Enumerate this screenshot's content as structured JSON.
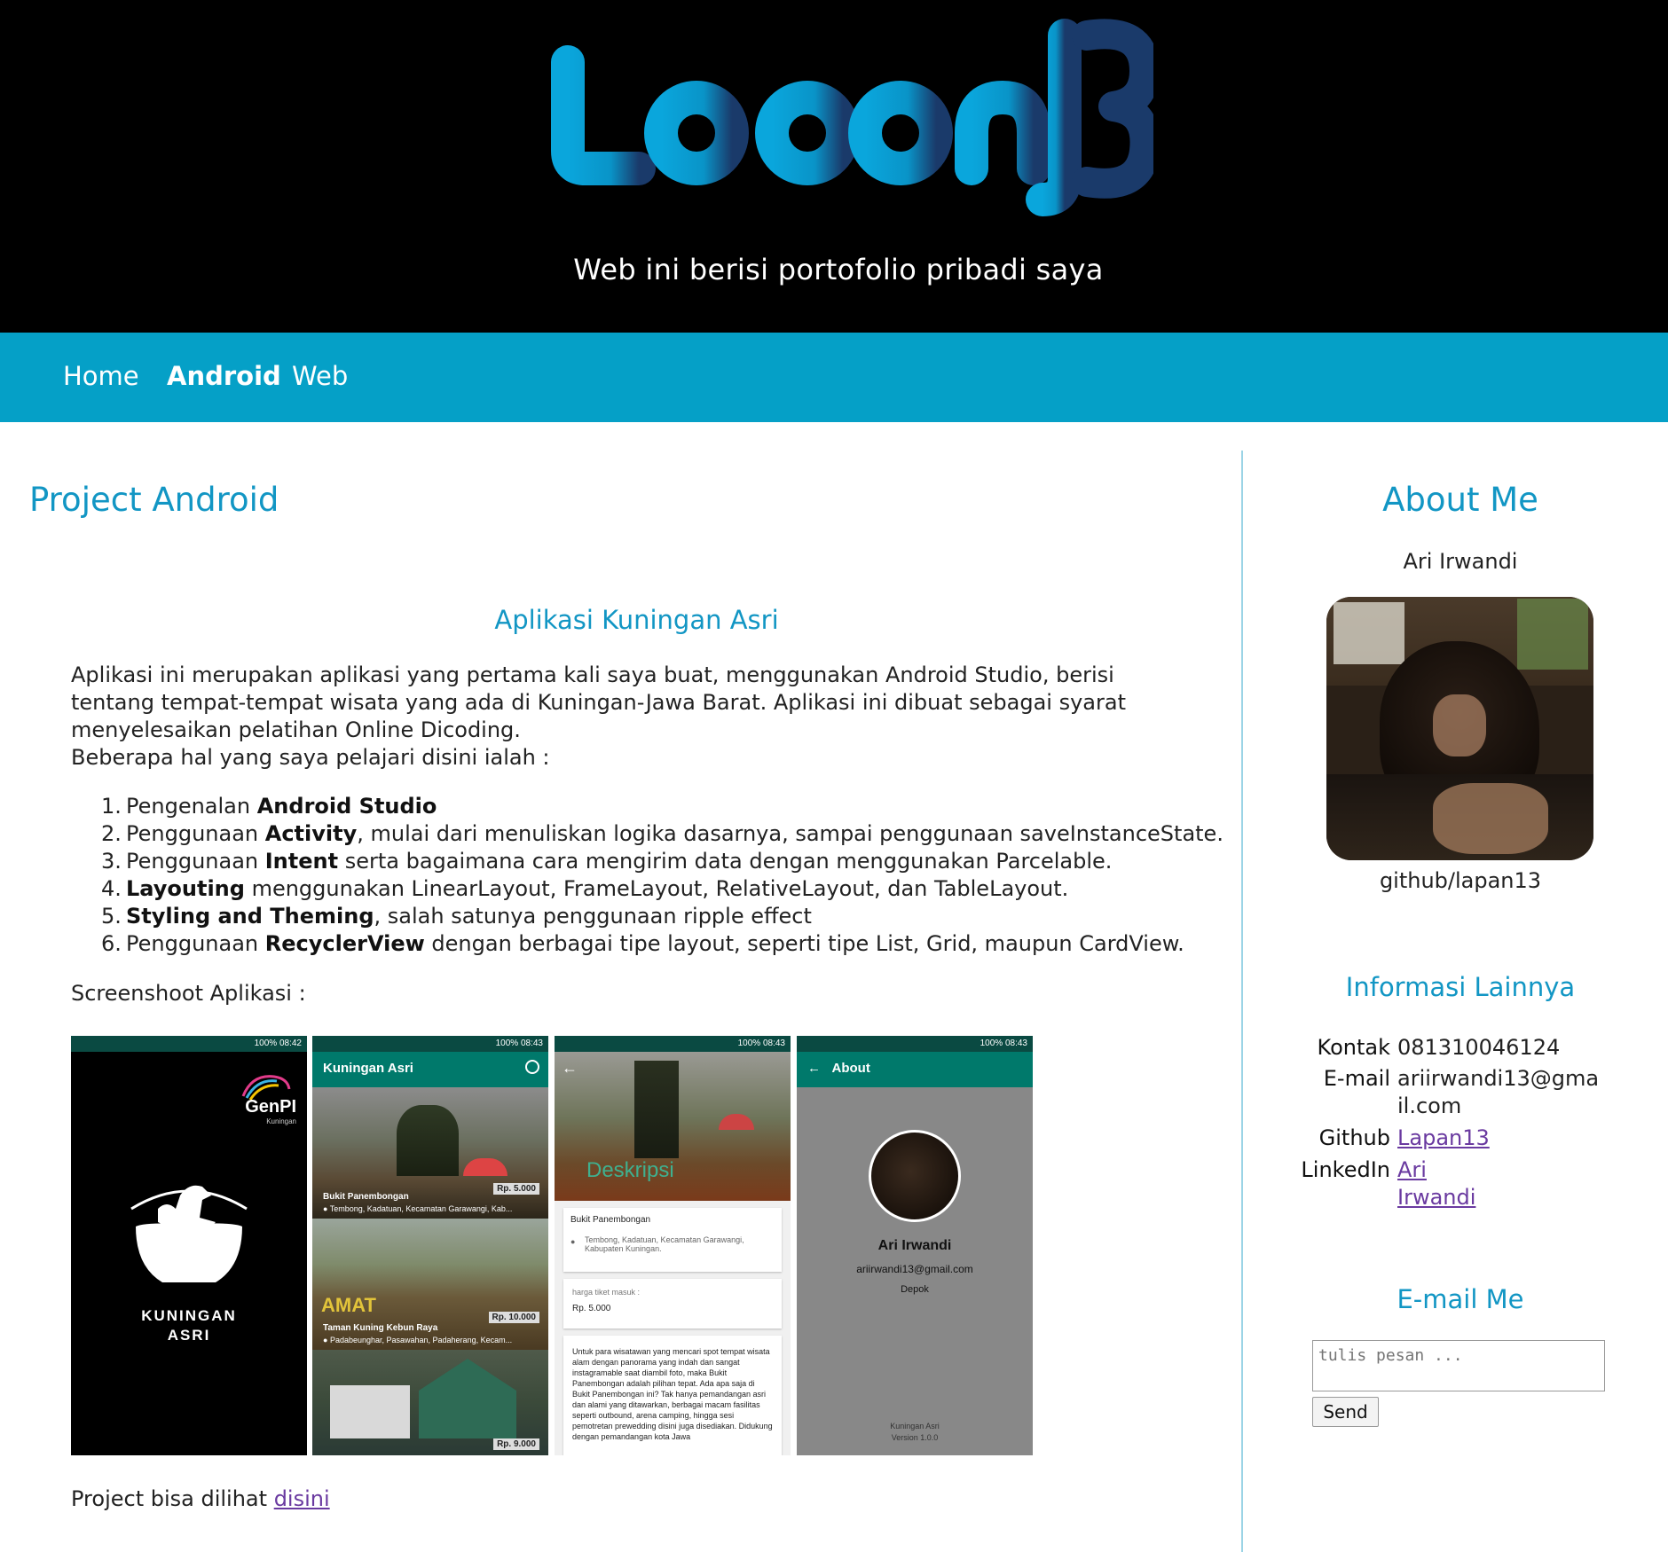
{
  "header": {
    "logo_text": "Lapan13",
    "tagline": "Web ini berisi portofolio pribadi saya"
  },
  "nav": {
    "items": [
      {
        "label": "Home"
      },
      {
        "label": "Android"
      },
      {
        "label": "Web"
      }
    ],
    "active": "Android"
  },
  "main": {
    "page_title": "Project Android",
    "article_title": "Aplikasi Kuningan Asri",
    "intro_paragraph": "Aplikasi ini merupakan aplikasi yang pertama kali saya buat, menggunakan Android Studio, berisi tentang tempat-tempat wisata yang ada di Kuningan-Jawa Barat. Aplikasi ini dibuat sebagai syarat menyelesaikan pelatihan Online Dicoding.",
    "intro_lead": "Beberapa hal yang saya pelajari disini ialah :",
    "learn_items": [
      {
        "num": "1.",
        "pre": "Pengenalan ",
        "bold": "Android Studio",
        "post": ""
      },
      {
        "num": "2.",
        "pre": "Penggunaan ",
        "bold": "Activity",
        "post": ", mulai dari menuliskan logika dasarnya, sampai penggunaan saveInstanceState."
      },
      {
        "num": "3.",
        "pre": "Penggunaan ",
        "bold": "Intent",
        "post": " serta bagaimana cara mengirim data dengan menggunakan Parcelable."
      },
      {
        "num": "4.",
        "pre": "",
        "bold": "Layouting",
        "post": " menggunakan LinearLayout, FrameLayout, RelativeLayout, dan TableLayout."
      },
      {
        "num": "5.",
        "pre": "",
        "bold": "Styling and Theming",
        "post": ", salah satunya penggunaan ripple effect"
      },
      {
        "num": "6.",
        "pre": "Penggunaan ",
        "bold": "RecyclerView",
        "post": " dengan berbagai tipe layout, seperti tipe List, Grid, maupun CardView."
      }
    ],
    "screens_label": "Screenshoot Aplikasi :",
    "screens": {
      "status_time_1": "08:42",
      "status_time": "08:43",
      "status_battery": "100%",
      "splash": {
        "brand": "GenPI",
        "brand_sub": "Kuningan",
        "app_name_1": "KUNINGAN",
        "app_name_2": "ASRI"
      },
      "list": {
        "title": "Kuningan Asri",
        "items": [
          {
            "name": "Bukit Panembongan",
            "loc": "Tembong, Kadatuan, Kecamatan Garawangi, Kab...",
            "price": "Rp. 5.000"
          },
          {
            "name": "Taman Kuning Kebun Raya",
            "loc": "Padabeunghar, Pasawahan, Padaherang, Kecam...",
            "price": "Rp. 10.000"
          },
          {
            "name": "",
            "loc": "",
            "price": "Rp. 9.000"
          }
        ],
        "overlay_word": "AMAT"
      },
      "detail": {
        "header_word": "Deskripsi",
        "name": "Bukit Panembongan",
        "location": "Tembong, Kadatuan, Kecamatan Garawangi, Kabupaten Kuningan.",
        "price_label": "harga tiket masuk :",
        "price": "Rp. 5.000",
        "description": "Untuk para wisatawan yang mencari spot tempat wisata alam dengan panorama yang indah dan sangat instagramable saat diambil foto, maka Bukit Panembongan adalah pilihan tepat. Ada apa saja di Bukit Panembongan ini? Tak hanya pemandangan asri dan alami yang ditawarkan, berbagai macam fasilitas seperti outbound, arena camping, hingga sesi pemotretan prewedding disini juga disediakan. Didukung dengan pemandangan kota Jawa"
      },
      "about": {
        "title": "About",
        "name": "Ari Irwandi",
        "email": "ariirwandi13@gmail.com",
        "city": "Depok",
        "app": "Kuningan Asri",
        "version": "Version 1.0.0"
      }
    },
    "footer_text": "Project bisa dilihat ",
    "footer_link": "disini"
  },
  "sidebar": {
    "about_title": "About Me",
    "name": "Ari Irwandi",
    "github_handle": "github/lapan13",
    "info_title": "Informasi Lainnya",
    "info": [
      {
        "label": "Kontak",
        "value": "081310046124",
        "link": false
      },
      {
        "label": "E-mail",
        "value": "ariirwandi13@gmail.com",
        "link": false
      },
      {
        "label": "Github",
        "value": "Lapan13",
        "link": true
      },
      {
        "label": "LinkedIn",
        "value": "Ari Irwandi",
        "link": true
      }
    ],
    "email_title": "E-mail Me",
    "message_placeholder": "tulis pesan ...",
    "send_label": "Send"
  },
  "colors": {
    "header_bg": "#000000",
    "nav_bg": "#05a0c7",
    "accent": "#1296c4",
    "link_visited": "#6a3aa0",
    "app_teal": "#00796b"
  }
}
